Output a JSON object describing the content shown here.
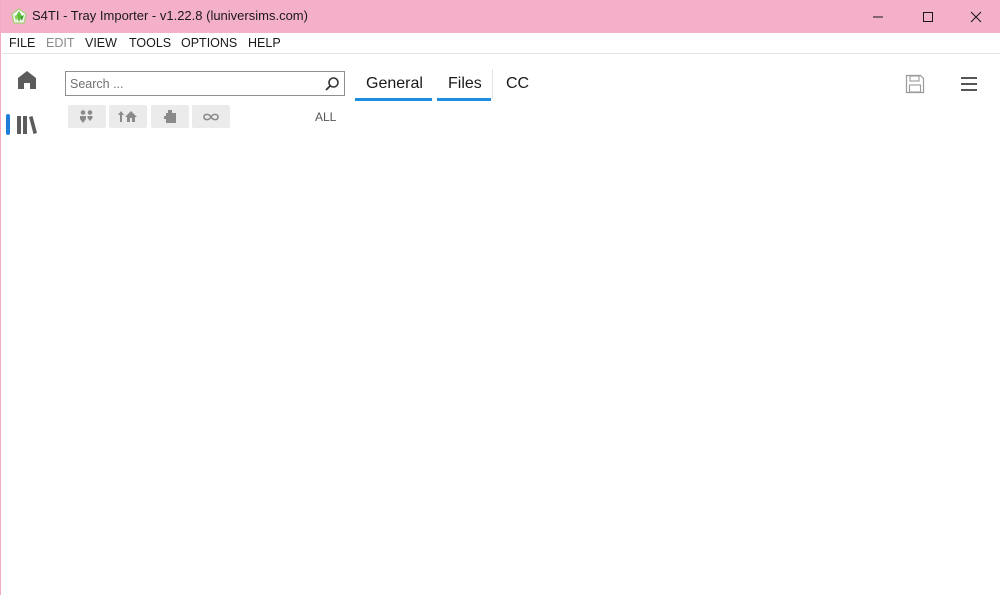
{
  "window": {
    "title": "S4TI - Tray Importer - v1.22.8  (luniversims.com)"
  },
  "menu": {
    "items": [
      {
        "label": "FILE",
        "enabled": true
      },
      {
        "label": "EDIT",
        "enabled": false
      },
      {
        "label": "VIEW",
        "enabled": true
      },
      {
        "label": "TOOLS",
        "enabled": true
      },
      {
        "label": "OPTIONS",
        "enabled": true
      },
      {
        "label": "HELP",
        "enabled": true
      }
    ]
  },
  "search": {
    "placeholder": "Search ...",
    "value": ""
  },
  "filters": {
    "buttons": [
      {
        "icon": "households-icon"
      },
      {
        "icon": "lots-icon"
      },
      {
        "icon": "rooms-icon"
      },
      {
        "icon": "infinity-icon"
      }
    ],
    "scope_label": "ALL"
  },
  "tabs": [
    {
      "label": "General",
      "active": true
    },
    {
      "label": "Files",
      "active": true
    },
    {
      "label": "CC",
      "active": false
    }
  ],
  "colors": {
    "titlebar": "#f4afc9",
    "accent": "#1e8fe0",
    "rail_indicator": "#1e7fd8"
  },
  "icons": {
    "home": "home-icon",
    "library": "library-icon",
    "save": "save-icon",
    "menu": "hamburger-icon"
  }
}
